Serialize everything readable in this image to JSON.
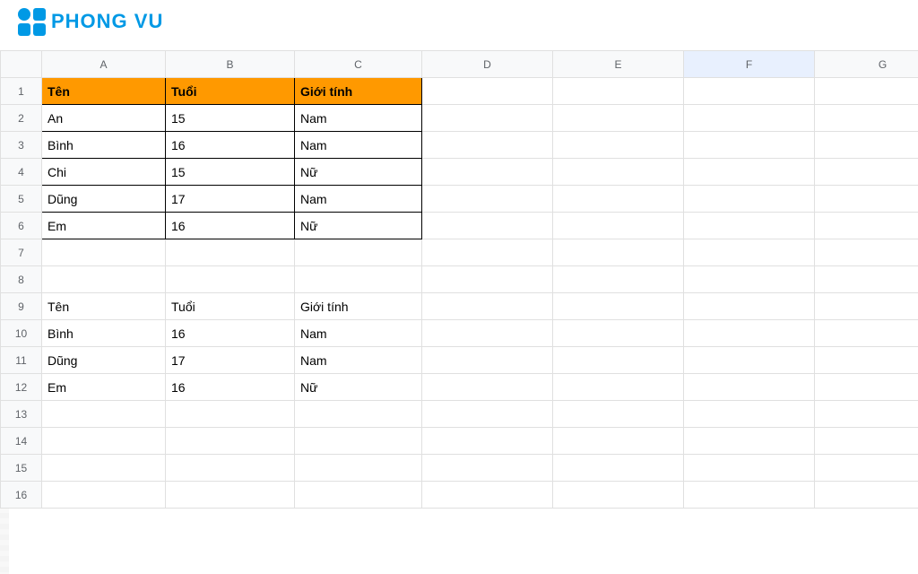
{
  "brand": {
    "name": "PHONG VU"
  },
  "columns": [
    "A",
    "B",
    "C",
    "D",
    "E",
    "F",
    "G"
  ],
  "selectedColumn": "F",
  "rowCount": 16,
  "tableRange": {
    "startRow": 1,
    "endRow": 6,
    "startCol": "A",
    "endCol": "C"
  },
  "cells": {
    "A1": "Tên",
    "B1": "Tuổi",
    "C1": "Giới tính",
    "A2": "An",
    "B2": "15",
    "C2": "Nam",
    "A3": "Bình",
    "B3": "16",
    "C3": "Nam",
    "A4": "Chi",
    "B4": "15",
    "C4": "Nữ",
    "A5": "Dũng",
    "B5": "17",
    "C5": "Nam",
    "A6": "Em",
    "B6": "16",
    "C6": "Nữ",
    "A9": "Tên",
    "B9": "Tuổi",
    "C9": "Giới tính",
    "A10": "Bình",
    "B10": "16",
    "C10": "Nam",
    "A11": "Dũng",
    "B11": "17",
    "C11": "Nam",
    "A12": "Em",
    "B12": "16",
    "C12": "Nữ"
  },
  "rightAligned": [
    "B10",
    "B11",
    "B12"
  ]
}
